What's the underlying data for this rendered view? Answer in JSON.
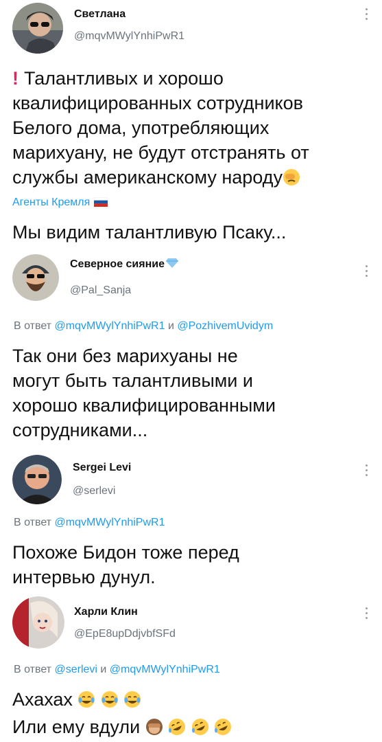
{
  "tweets": [
    {
      "name": "Светлана",
      "handle": "@mqvMWylYnhiPwR1",
      "body_lines": [
        "Талантливых и хорошо",
        "квалифицированных сотрудников",
        "Белого дома, употребляющих",
        "марихуану, не будут отстранять от",
        "службы американскому народу"
      ],
      "tag": "Агенты Кремля",
      "body_tail": "Мы видим талантливую Псаку..."
    },
    {
      "name": "Северное сияние",
      "handle": "@Pal_Sanja",
      "reply_prefix": "В ответ",
      "reply_mention_1": "@mqvMWylYnhiPwR1",
      "reply_and": "и",
      "reply_mention_2": "@PozhivemUvidym",
      "body_lines": [
        "Так они без марихуаны не",
        "могут быть талантливыми и",
        "хорошо квалифицированными",
        "сотрудниками..."
      ]
    },
    {
      "name": "Sergei Levi",
      "handle": "@serlevi",
      "reply_prefix": "В ответ",
      "reply_mention_1": "@mqvMWylYnhiPwR1",
      "body_lines": [
        "Похоже Бидон тоже перед",
        "интервью дунул."
      ]
    },
    {
      "name": "Харли Клин",
      "handle": "@EpE8upDdjvbfSFd",
      "reply_prefix": "В ответ",
      "reply_mention_1": "@serlevi",
      "reply_and": "и",
      "reply_mention_2": "@mqvMWylYnhiPwR1",
      "body_lines": [
        "Ахахах",
        "Или ему вдули"
      ]
    }
  ]
}
